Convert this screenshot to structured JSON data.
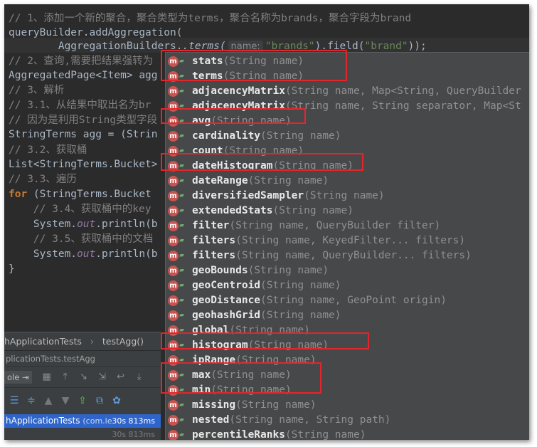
{
  "code": {
    "lines": [
      {
        "segments": [
          {
            "text": "// 1、添加一个新的聚合，聚合类型为terms，聚合名称为brands，聚合字段为brand",
            "cls": "cm"
          }
        ]
      },
      {
        "segments": [
          {
            "text": "queryBuilder.addAggregation(",
            "cls": ""
          }
        ]
      },
      {
        "segments": [
          {
            "text": "        AggregationBuilders.",
            "cls": ""
          },
          {
            "text": ".terms(",
            "cls": "mi"
          },
          {
            "text": "name:",
            "cls": "hint"
          },
          {
            "text": "\"brands\"",
            "cls": "str"
          },
          {
            "text": ").field(",
            "cls": ""
          },
          {
            "text": "\"brand\"",
            "cls": "str"
          },
          {
            "text": "));",
            "cls": ""
          }
        ]
      },
      {
        "segments": [
          {
            "text": "// 2、查询,需要把结果强转为",
            "cls": "cm"
          }
        ]
      },
      {
        "segments": [
          {
            "text": "AggregatedPage<Item> agg",
            "cls": ""
          }
        ]
      },
      {
        "segments": [
          {
            "text": "// 3、解析",
            "cls": "cm"
          }
        ]
      },
      {
        "segments": [
          {
            "text": "// 3.1、从结果中取出名为br",
            "cls": "cm"
          }
        ]
      },
      {
        "segments": [
          {
            "text": "// 因为是利用String类型字段",
            "cls": "cm"
          }
        ]
      },
      {
        "segments": [
          {
            "text": "StringTerms agg = (Strin",
            "cls": ""
          }
        ]
      },
      {
        "segments": [
          {
            "text": "// 3.2、获取桶",
            "cls": "cm"
          }
        ]
      },
      {
        "segments": [
          {
            "text": "List<StringTerms.Bucket>",
            "cls": ""
          }
        ]
      },
      {
        "segments": [
          {
            "text": "// 3.3、遍历",
            "cls": "cm"
          }
        ]
      },
      {
        "segments": [
          {
            "text": "for",
            "cls": "kw"
          },
          {
            "text": " (StringTerms.Bucket ",
            "cls": ""
          }
        ]
      },
      {
        "segments": [
          {
            "text": "    // 3.4、获取桶中的key",
            "cls": "cm"
          }
        ]
      },
      {
        "segments": [
          {
            "text": "    System.",
            "cls": ""
          },
          {
            "text": "out",
            "cls": "it"
          },
          {
            "text": ".println(b",
            "cls": ""
          }
        ]
      },
      {
        "segments": [
          {
            "text": "    // 3.5、获取桶中的文档",
            "cls": "cm"
          }
        ]
      },
      {
        "segments": [
          {
            "text": "    System.",
            "cls": ""
          },
          {
            "text": "out",
            "cls": "it"
          },
          {
            "text": ".println(b",
            "cls": ""
          }
        ]
      },
      {
        "segments": [
          {
            "text": "}",
            "cls": ""
          }
        ]
      }
    ]
  },
  "breadcrumb": {
    "class_name": "hApplicationTests",
    "method_name": "testAgg()"
  },
  "run_tab": {
    "label": "plicationTests.testAgg"
  },
  "toolbar": {
    "label": "ole"
  },
  "results": {
    "selected": {
      "name": "hApplicationTests",
      "package": "(com.le",
      "time": "30s 813ms"
    },
    "second": {
      "time": "30s 813ms"
    }
  },
  "completion": {
    "icon_letter": "m",
    "items": [
      {
        "name": "stats",
        "params": "(String name)"
      },
      {
        "name": "terms",
        "params": "(String name)"
      },
      {
        "name": "adjacencyMatrix",
        "params": "(String name, Map<String, QueryBuilder"
      },
      {
        "name": "adjacencyMatrix",
        "params": "(String name, String separator, Map<St"
      },
      {
        "name": "avg",
        "params": "(String name)"
      },
      {
        "name": "cardinality",
        "params": "(String name)"
      },
      {
        "name": "count",
        "params": "(String name)"
      },
      {
        "name": "dateHistogram",
        "params": "(String name)"
      },
      {
        "name": "dateRange",
        "params": "(String name)"
      },
      {
        "name": "diversifiedSampler",
        "params": "(String name)"
      },
      {
        "name": "extendedStats",
        "params": "(String name)"
      },
      {
        "name": "filter",
        "params": "(String name, QueryBuilder filter)"
      },
      {
        "name": "filters",
        "params": "(String name, KeyedFilter... filters)"
      },
      {
        "name": "filters",
        "params": "(String name, QueryBuilder... filters)"
      },
      {
        "name": "geoBounds",
        "params": "(String name)"
      },
      {
        "name": "geoCentroid",
        "params": "(String name)"
      },
      {
        "name": "geoDistance",
        "params": "(String name, GeoPoint origin)"
      },
      {
        "name": "geohashGrid",
        "params": "(String name)"
      },
      {
        "name": "global",
        "params": "(String name)"
      },
      {
        "name": "histogram",
        "params": "(String name)"
      },
      {
        "name": "ipRange",
        "params": "(String name)"
      },
      {
        "name": "max",
        "params": "(String name)"
      },
      {
        "name": "min",
        "params": "(String name)"
      },
      {
        "name": "missing",
        "params": "(String name)"
      },
      {
        "name": "nested",
        "params": "(String name, String path)"
      },
      {
        "name": "percentileRanks",
        "params": "(String name)"
      }
    ]
  },
  "colors": {
    "highlight_box": "#e3262c",
    "selection": "#2f65ca",
    "editor_bg": "#2b2b2b",
    "popup_bg": "#46484a"
  }
}
